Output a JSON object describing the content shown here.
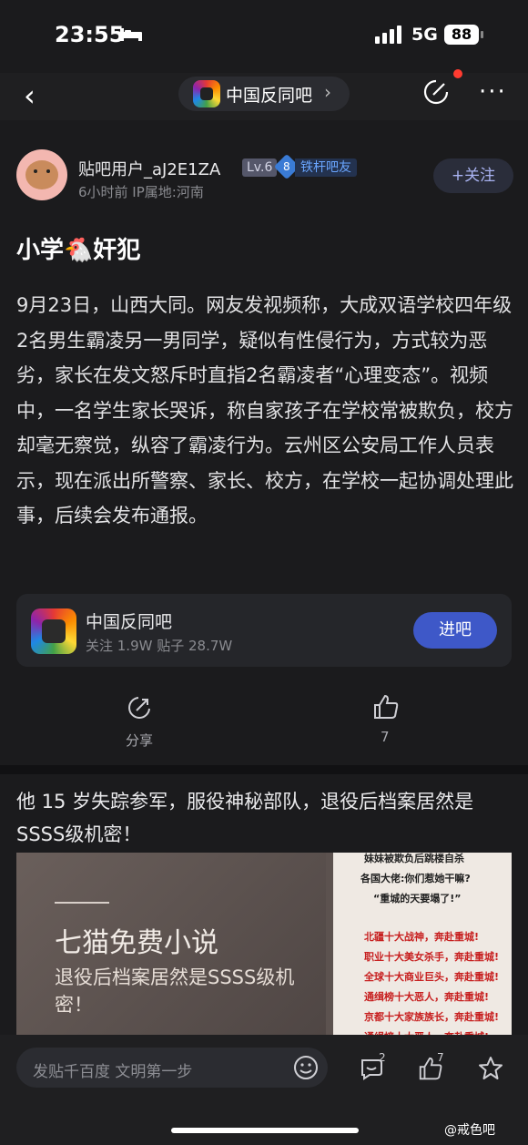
{
  "status_bar": {
    "time": "23:55",
    "network": "5G",
    "battery": "88"
  },
  "nav": {
    "forum_name": "中国反同吧",
    "chevron": "›",
    "back": "‹",
    "more": "···"
  },
  "author": {
    "name": "贴吧用户_aJ2E1ZA",
    "level": "Lv.6",
    "badge_number": "8",
    "badge_label": "铁杆吧友",
    "meta": "6小时前  IP属地:河南",
    "follow_label": "+关注"
  },
  "post": {
    "title": "小学🐔奸犯",
    "body": "9月23日，山西大同。网友发视频称，大成双语学校四年级2名男生霸凌另一男同学，疑似有性侵行为，方式较为恶劣，家长在发文怒斥时直指2名霸凌者“心理变态”。视频中，一名学生家长哭诉，称自家孩子在学校常被欺负，校方却毫无察觉，纵容了霸凌行为。云州区公安局工作人员表示，现在派出所警察、家长、校方，在学校一起协调处理此事，后续会发布通报。"
  },
  "forum_card": {
    "name": "中国反同吧",
    "stats": "关注 1.9W  贴子 28.7W",
    "join_label": "进吧"
  },
  "actions": {
    "share_label": "分享",
    "like_count": "7"
  },
  "recommend": {
    "title": "他 15 岁失踪参军，服役神秘部队，退役后档案居然是SSSS级机密！",
    "brand": "七猫免费小说",
    "desc": "退役后档案居然是SSSS级机密！",
    "right_lines": [
      "妹妹被欺负后跳楼自杀",
      "各国大佬:你们惹她干嘛?",
      "“重城的天要塌了!”",
      "北疆十大战神，奔赴重城!",
      "职业十大美女杀手，奔赴重城!",
      "全球十大商业巨头，奔赴重城!",
      "通缉榜十大恶人，奔赴重城!",
      "京都十大家族族长，奔赴重城!",
      "通缉榜十大恶人，奔赴重城!"
    ]
  },
  "bottom_bar": {
    "input_placeholder": "发贴千百度 文明第一步",
    "comment_count": "2",
    "like_count": "7"
  },
  "watermark": "@戒色吧",
  "colors": {
    "background": "#1b1b1d",
    "accent": "#3e58c8",
    "red_dot": "#ff3b30"
  }
}
